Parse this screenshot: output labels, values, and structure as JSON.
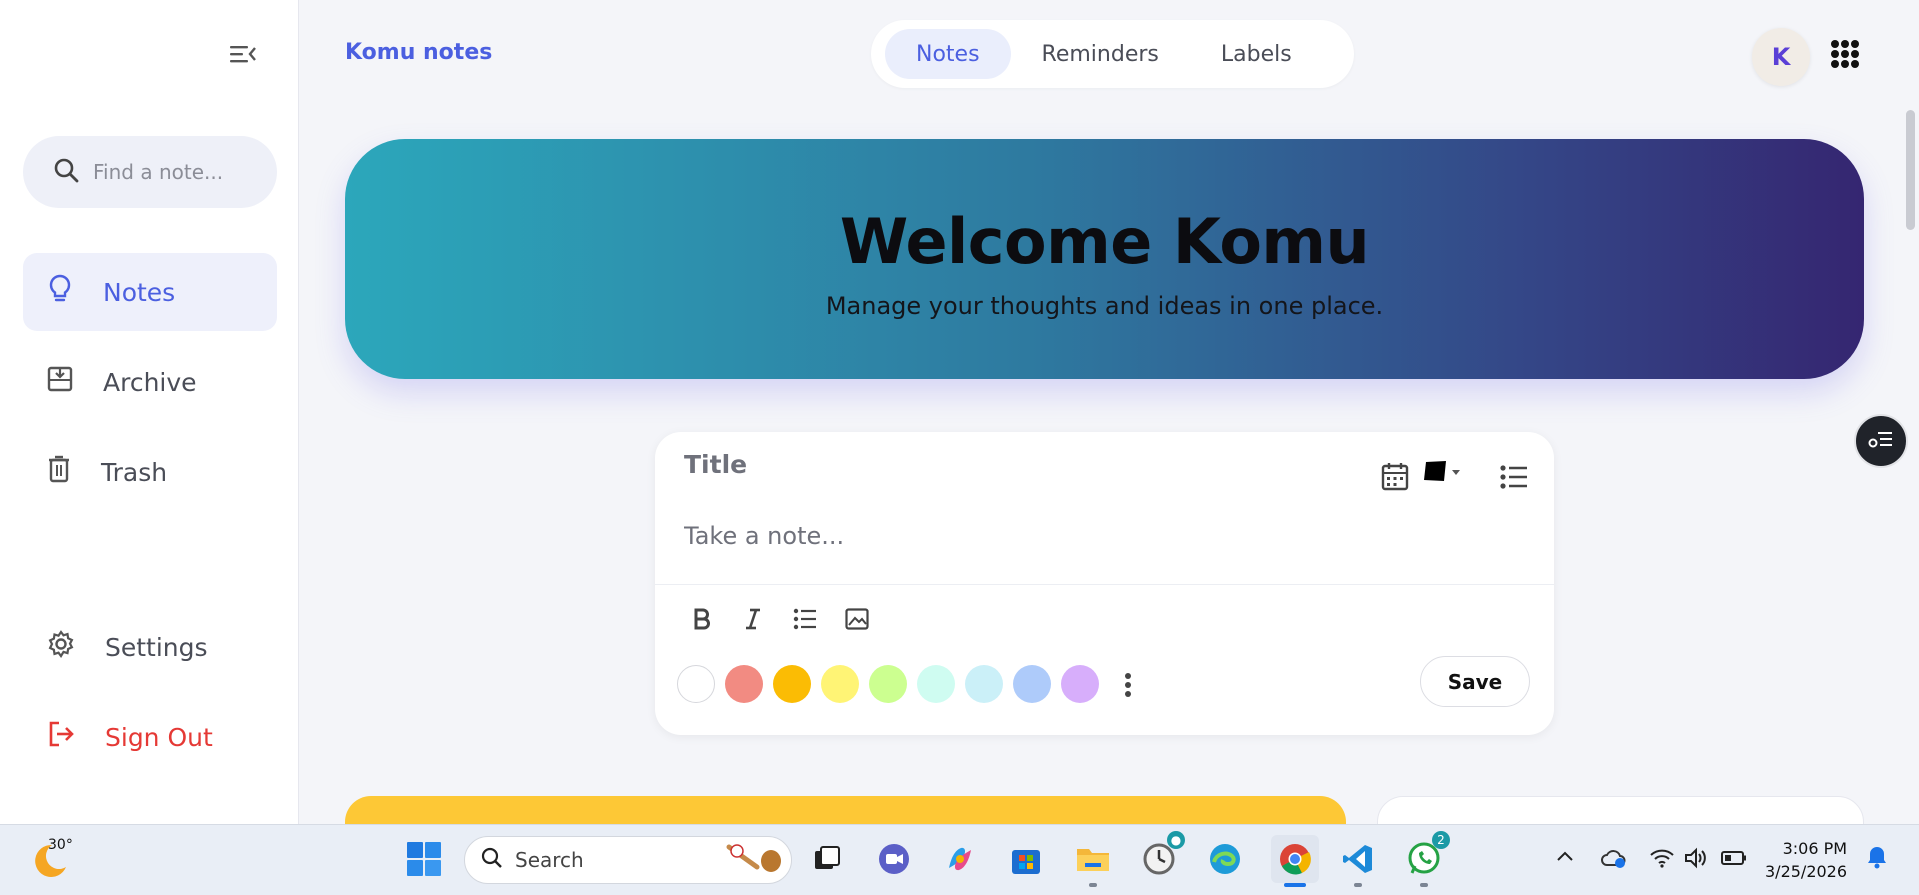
{
  "sidebar": {
    "search_placeholder": "Find a note...",
    "items": [
      {
        "label": "Notes",
        "icon": "lightbulb-icon"
      },
      {
        "label": "Archive",
        "icon": "archive-icon"
      },
      {
        "label": "Trash",
        "icon": "trash-icon"
      }
    ],
    "settings_label": "Settings",
    "signout_label": "Sign Out"
  },
  "header": {
    "brand": "Komu notes",
    "tabs": [
      {
        "label": "Notes"
      },
      {
        "label": "Reminders"
      },
      {
        "label": "Labels"
      }
    ],
    "avatar_initial": "K"
  },
  "hero": {
    "title": "Welcome Komu",
    "subtitle": "Manage your thoughts and ideas in one place."
  },
  "editor": {
    "title_placeholder": "Title",
    "body_placeholder": "Take a note...",
    "colors": [
      "#ffffff",
      "#f28b82",
      "#fbbc04",
      "#fff475",
      "#ccff90",
      "#cffcf1",
      "#cbf0f8",
      "#aecbfa",
      "#d7aefb"
    ],
    "save_label": "Save"
  },
  "colors": {
    "accent": "#4b5fe0",
    "danger": "#e53935",
    "hero_start": "#2ca7bb",
    "hero_end": "#352671"
  },
  "taskbar": {
    "weather_temp": "30°",
    "search_placeholder": "Search",
    "clock_time": "3:06 PM",
    "clock_date": "3/25/2026",
    "whatsapp_badge": "2"
  }
}
